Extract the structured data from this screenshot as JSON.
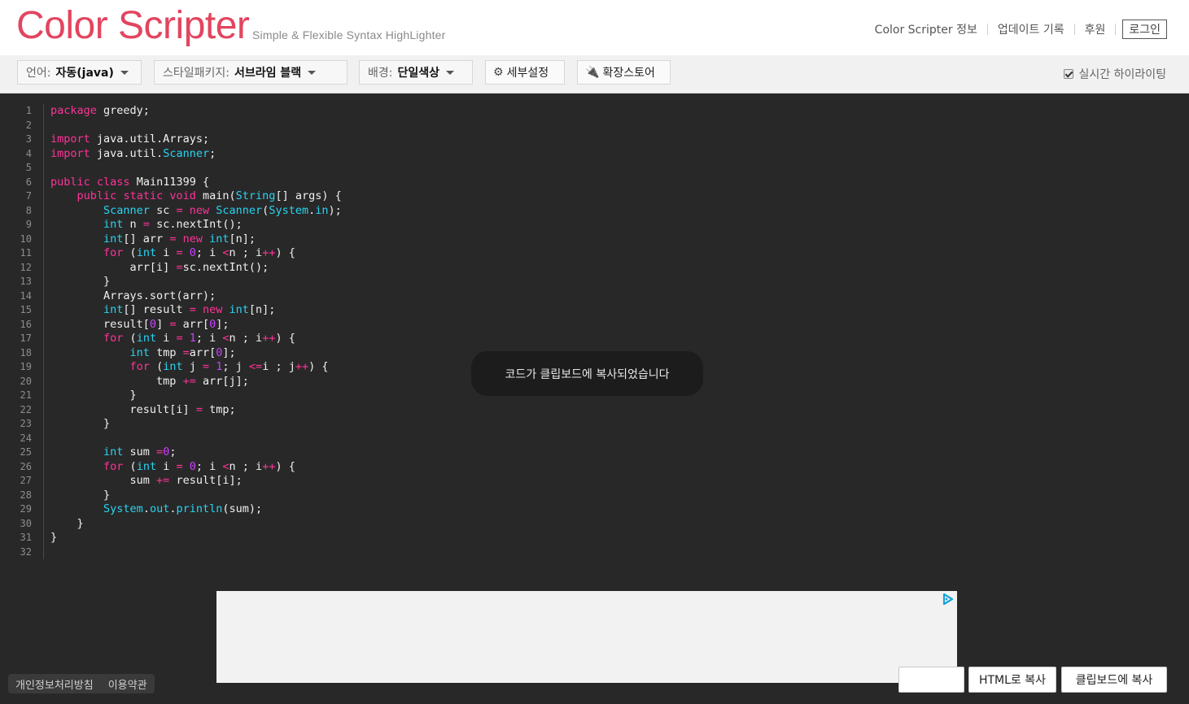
{
  "header": {
    "logo": "Color Scripter",
    "tagline": "Simple & Flexible Syntax HighLighter",
    "nav": [
      "Color Scripter 정보",
      "업데이트 기록",
      "후원"
    ],
    "login": "로그인"
  },
  "toolbar": {
    "language": {
      "label": "언어:",
      "value": "자동(java)"
    },
    "style": {
      "label": "스타일패키지:",
      "value": "서브라임 블랙"
    },
    "background": {
      "label": "배경:",
      "value": "단일색상"
    },
    "settings": "세부설정",
    "store": "확장스토어",
    "realtime": {
      "label": "실시간 하이라이팅",
      "checked": true
    }
  },
  "editor": {
    "line_count": 32,
    "lines": [
      "package greedy;",
      "",
      "import java.util.Arrays;",
      "import java.util.Scanner;",
      "",
      "public class Main11399 {",
      "    public static void main(String[] args) {",
      "        Scanner sc = new Scanner(System.in);",
      "        int n = sc.nextInt();",
      "        int[] arr = new int[n];",
      "        for (int i = 0; i <n ; i++) {",
      "            arr[i] =sc.nextInt();",
      "        }",
      "        Arrays.sort(arr);",
      "        int[] result = new int[n];",
      "        result[0] = arr[0];",
      "        for (int i = 1; i <n ; i++) {",
      "            int tmp =arr[0];",
      "            for (int j = 1; j <=i ; j++) {",
      "                tmp += arr[j];",
      "            }",
      "            result[i] = tmp;",
      "        }",
      "",
      "        int sum =0;",
      "        for (int i = 0; i <n ; i++) {",
      "            sum += result[i];",
      "        }",
      "        System.out.println(sum);",
      "    }",
      "}",
      ""
    ]
  },
  "toast": "코드가 클립보드에 복사되었습니다",
  "footer": {
    "privacy": "개인정보처리방침",
    "terms": "이용약관"
  },
  "actions": {
    "html_copy": "HTML로 복사",
    "clipboard_copy": "클립보드에 복사"
  },
  "colors": {
    "accent": "#e2455f",
    "keyword": "#ff3399",
    "type": "#28d4f2",
    "number": "#c840ff",
    "editor_bg": "#282828"
  }
}
